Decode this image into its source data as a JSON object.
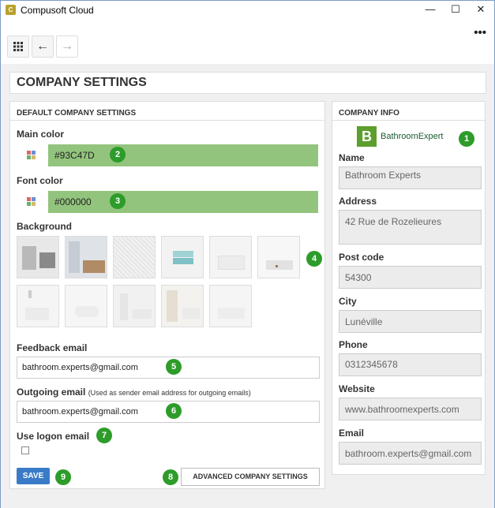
{
  "window": {
    "title": "Compusoft Cloud",
    "icon": "app-logo-icon",
    "minimize": "—",
    "maximize": "☐",
    "close": "✕",
    "more": "•••"
  },
  "toolbar": {
    "apps_glyph": "⠿",
    "back_glyph": "←",
    "forward_glyph": "→"
  },
  "page": {
    "title": "COMPANY SETTINGS"
  },
  "default_settings": {
    "header": "DEFAULT COMPANY SETTINGS",
    "main_color_label": "Main color",
    "main_color_value": "#93C47D",
    "main_color": "#93c47d",
    "font_color_label": "Font color",
    "font_color_value": "#000000",
    "background_label": "Background",
    "backgrounds": [
      "bathroom-1",
      "bathroom-2",
      "texture",
      "towels",
      "white-bath",
      "vanity",
      "bath-3",
      "bath-4",
      "bath-5",
      "bath-6",
      "bath-7"
    ],
    "feedback_label": "Feedback email",
    "feedback_value": "bathroom.experts@gmail.com",
    "outgoing_label": "Outgoing email",
    "outgoing_note": "(Used as sender email address for outgoing emails)",
    "outgoing_value": "bathroom.experts@gmail.com",
    "logon_label": "Use logon email",
    "logon_checked": false,
    "save_label": "SAVE",
    "advanced_label": "ADVANCED COMPANY SETTINGS"
  },
  "company_info": {
    "header": "COMPANY INFO",
    "logo_text": "BathroomExpert",
    "logo_mark": "B",
    "name_label": "Name",
    "name_value": "Bathroom Experts",
    "address_label": "Address",
    "address_value": "42 Rue de Rozelieures",
    "postcode_label": "Post code",
    "postcode_value": "54300",
    "city_label": "City",
    "city_value": "Lunéville",
    "phone_label": "Phone",
    "phone_value": "0312345678",
    "website_label": "Website",
    "website_value": "www.bathroomexperts.com",
    "email_label": "Email",
    "email_value": "bathroom.experts@gmail.com"
  },
  "badges": [
    "1",
    "2",
    "3",
    "4",
    "5",
    "6",
    "7",
    "8",
    "9"
  ],
  "colors": {
    "accent": "#3a7bc8",
    "badge": "#2d9c2a",
    "main": "#93c47d"
  }
}
